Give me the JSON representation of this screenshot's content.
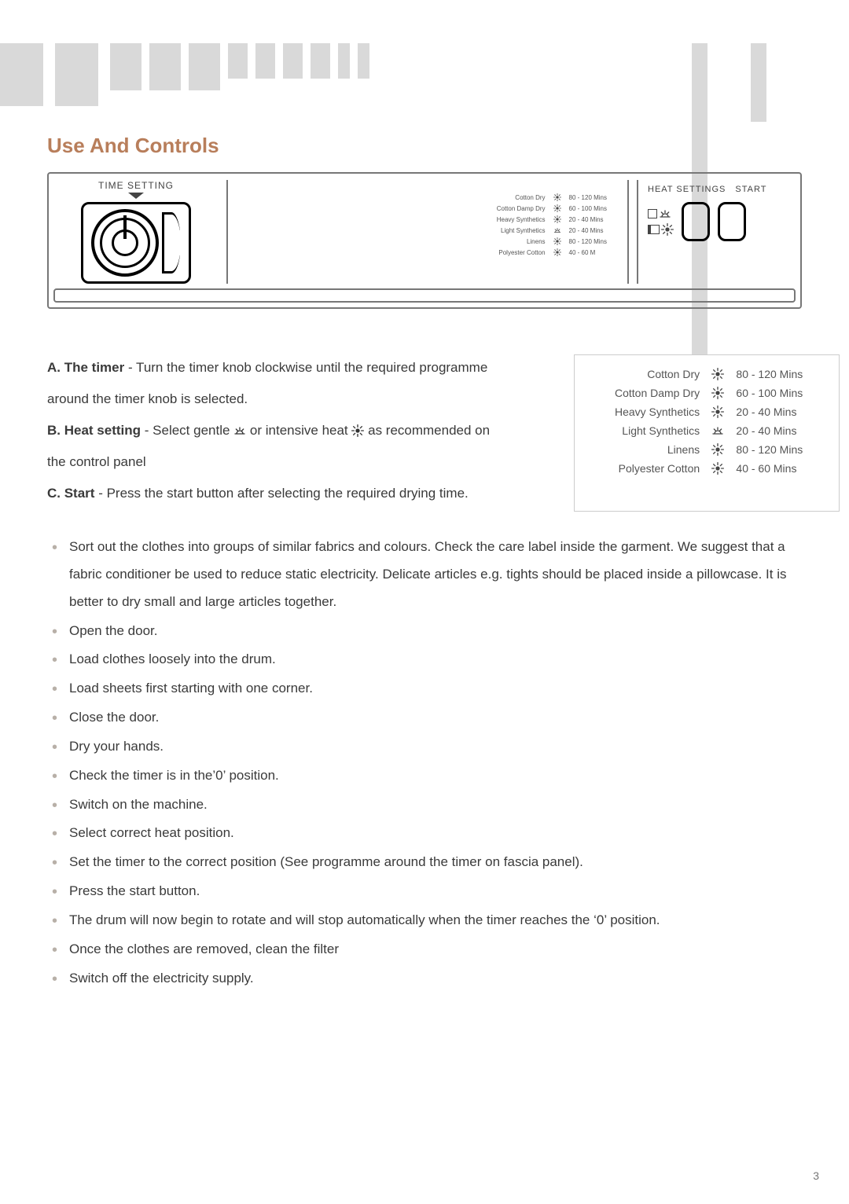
{
  "section_title": "Use And Controls",
  "panel": {
    "time_setting_label": "TIME SETTING",
    "heat_label": "HEAT SETTINGS",
    "start_label": "START",
    "mid_table": [
      {
        "name": "Cotton Dry",
        "heat": "full",
        "time": "80 - 120 Mins"
      },
      {
        "name": "Cotton Damp Dry",
        "heat": "full",
        "time": "60 - 100 Mins"
      },
      {
        "name": "Heavy Synthetics",
        "heat": "full",
        "time": "20 - 40   Mins"
      },
      {
        "name": "Light Synthetics",
        "heat": "half",
        "time": "20 - 40   Mins"
      },
      {
        "name": "Linens",
        "heat": "full",
        "time": "80 - 120 Mins"
      },
      {
        "name": "Polyester Cotton",
        "heat": "full",
        "time": "40 - 60   M"
      }
    ]
  },
  "instructions": {
    "a_bold": "A. The timer",
    "a_text_1": " - Turn the timer knob clockwise until the required programme",
    "a_text_2": " around the  timer knob is selected.",
    "b_bold": "B. Heat setting",
    "b_text_1": " - Select gentle ",
    "b_text_2": " or intensive heat ",
    "b_text_3": " as recommended on",
    "b_text_4": " the control panel",
    "c_bold": "C. Start",
    "c_text": " - Press the start button after selecting the required drying time."
  },
  "side_table": [
    {
      "name": "Cotton Dry",
      "heat": "full",
      "time": "80 - 120 Mins"
    },
    {
      "name": "Cotton Damp Dry",
      "heat": "full",
      "time": "60 - 100 Mins"
    },
    {
      "name": "Heavy Synthetics",
      "heat": "full",
      "time": "20 - 40   Mins"
    },
    {
      "name": "Light Synthetics",
      "heat": "half",
      "time": "20 - 40   Mins"
    },
    {
      "name": "Linens",
      "heat": "full",
      "time": "80 - 120 Mins"
    },
    {
      "name": "Polyester Cotton",
      "heat": "full",
      "time": "40 - 60   Mins"
    }
  ],
  "bullets": [
    "Sort out the clothes into groups of similar fabrics and colours. Check the care label inside the garment. We suggest that a fabric conditioner be used to reduce static electricity. Delicate articles e.g. tights should be placed inside a pillowcase. It is better to dry small and large articles together.",
    "Open the door.",
    "Load clothes loosely into the drum.",
    "Load sheets first starting with one corner.",
    "Close the door.",
    "Dry your hands.",
    "Check the timer is in the’0’ position.",
    "Switch on the machine.",
    "Select correct heat position.",
    "Set the timer to the correct position (See programme around the timer on fascia panel).",
    "Press the start button.",
    "The drum will now begin to rotate and will stop automatically when the timer reaches the ‘0’ position.",
    "Once the clothes are removed, clean the filter",
    "Switch off the electricity supply."
  ],
  "page_number": "3"
}
